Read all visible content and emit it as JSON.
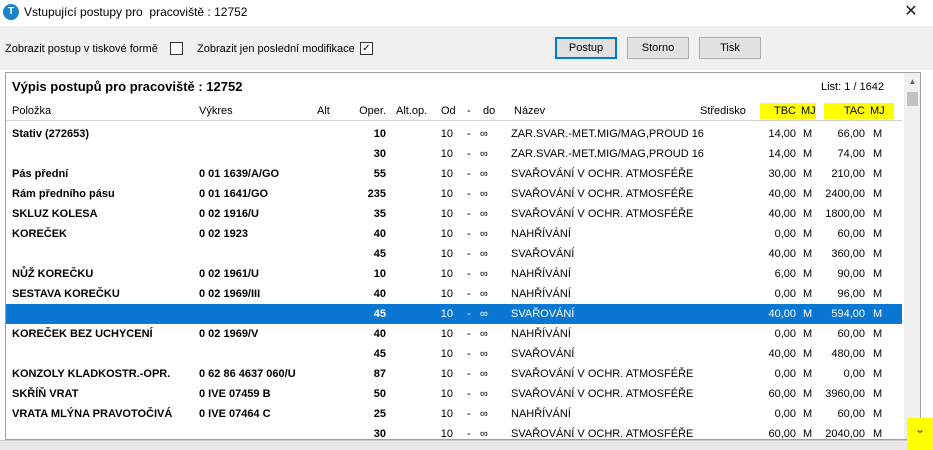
{
  "window": {
    "title": "Vstupující postupy pro  pracoviště : 12752",
    "app_icon": "app-logo-icon",
    "close_glyph": "✕"
  },
  "toolbar": {
    "option1_label": "Zobrazit postup v tiskové formě",
    "option1_checked": false,
    "option2_label": "Zobrazit jen poslední modifikace",
    "option2_checked": true,
    "check_glyph": "✓",
    "btn_postup": "Postup",
    "btn_storno": "Storno",
    "btn_tisk": "Tisk"
  },
  "report": {
    "title": "Výpis postupů pro pracoviště : 12752",
    "page_info": "List: 1 / 1642"
  },
  "columns": {
    "polozka": "Položka",
    "vykres": "Výkres",
    "alt": "Alt",
    "oper": "Oper.",
    "altop": "Alt.op.",
    "od": "Od",
    "dash": "-",
    "do": "do",
    "nazev": "Název",
    "stredisko": "Středisko",
    "tbc": "TBC",
    "mj1": "MJ",
    "tac": "TAC",
    "mj2": "MJ"
  },
  "highlight_color": "#ffff00",
  "selection_color": "#0a78d3",
  "rows": [
    {
      "polozka": "Stativ (272653)",
      "vykres": "",
      "oper": "10",
      "od": "10",
      "dash": "-",
      "do": "∞",
      "nazev": "ZAR.SVAR.-MET.MIG/MAG,PROUD 16",
      "tbc": "14,00",
      "mj1": "M",
      "tac": "66,00",
      "mj2": "M",
      "selected": false
    },
    {
      "polozka": "",
      "vykres": "",
      "oper": "30",
      "od": "10",
      "dash": "-",
      "do": "∞",
      "nazev": "ZAR.SVAR.-MET.MIG/MAG,PROUD 16",
      "tbc": "14,00",
      "mj1": "M",
      "tac": "74,00",
      "mj2": "M",
      "selected": false
    },
    {
      "polozka": "Pás přední",
      "vykres": "0 01 1639/A/GO",
      "oper": "55",
      "od": "10",
      "dash": "-",
      "do": "∞",
      "nazev": "SVAŘOVÁNÍ V OCHR. ATMOSFÉŘE",
      "tbc": "30,00",
      "mj1": "M",
      "tac": "210,00",
      "mj2": "M",
      "selected": false
    },
    {
      "polozka": "Rám předního pásu",
      "vykres": "0 01 1641/GO",
      "oper": "235",
      "od": "10",
      "dash": "-",
      "do": "∞",
      "nazev": "SVAŘOVÁNÍ V OCHR. ATMOSFÉŘE",
      "tbc": "40,00",
      "mj1": "M",
      "tac": "2400,00",
      "mj2": "M",
      "selected": false
    },
    {
      "polozka": "SKLUZ KOLESA",
      "vykres": "0 02 1916/U",
      "oper": "35",
      "od": "10",
      "dash": "-",
      "do": "∞",
      "nazev": "SVAŘOVÁNÍ V OCHR. ATMOSFÉŘE",
      "tbc": "40,00",
      "mj1": "M",
      "tac": "1800,00",
      "mj2": "M",
      "selected": false
    },
    {
      "polozka": "KOREČEK",
      "vykres": "0 02 1923",
      "oper": "40",
      "od": "10",
      "dash": "-",
      "do": "∞",
      "nazev": "NAHŘÍVÁNÍ",
      "tbc": "0,00",
      "mj1": "M",
      "tac": "60,00",
      "mj2": "M",
      "selected": false
    },
    {
      "polozka": "",
      "vykres": "",
      "oper": "45",
      "od": "10",
      "dash": "-",
      "do": "∞",
      "nazev": "SVAŘOVÁNÍ",
      "tbc": "40,00",
      "mj1": "M",
      "tac": "360,00",
      "mj2": "M",
      "selected": false
    },
    {
      "polozka": "NŮŽ KOREČKU",
      "vykres": "0 02 1961/U",
      "oper": "10",
      "od": "10",
      "dash": "-",
      "do": "∞",
      "nazev": "NAHŘÍVÁNÍ",
      "tbc": "6,00",
      "mj1": "M",
      "tac": "90,00",
      "mj2": "M",
      "selected": false
    },
    {
      "polozka": "SESTAVA KOREČKU",
      "vykres": "0 02 1969/III",
      "oper": "40",
      "od": "10",
      "dash": "-",
      "do": "∞",
      "nazev": "NAHŘÍVÁNÍ",
      "tbc": "0,00",
      "mj1": "M",
      "tac": "96,00",
      "mj2": "M",
      "selected": false
    },
    {
      "polozka": "",
      "vykres": "",
      "oper": "45",
      "od": "10",
      "dash": "-",
      "do": "∞",
      "nazev": "SVAŘOVÁNÍ",
      "tbc": "40,00",
      "mj1": "M",
      "tac": "594,00",
      "mj2": "M",
      "selected": true
    },
    {
      "polozka": "KOREČEK BEZ UCHYCENÍ",
      "vykres": "0 02 1969/V",
      "oper": "40",
      "od": "10",
      "dash": "-",
      "do": "∞",
      "nazev": "NAHŘÍVÁNÍ",
      "tbc": "0,00",
      "mj1": "M",
      "tac": "60,00",
      "mj2": "M",
      "selected": false
    },
    {
      "polozka": "",
      "vykres": "",
      "oper": "45",
      "od": "10",
      "dash": "-",
      "do": "∞",
      "nazev": "SVAŘOVÁNÍ",
      "tbc": "40,00",
      "mj1": "M",
      "tac": "480,00",
      "mj2": "M",
      "selected": false
    },
    {
      "polozka": "KONZOLY KLADKOSTR.-OPR.",
      "vykres": "0 62 86 4637 060/U",
      "oper": "87",
      "od": "10",
      "dash": "-",
      "do": "∞",
      "nazev": "SVAŘOVÁNÍ V OCHR. ATMOSFÉŘE",
      "tbc": "0,00",
      "mj1": "M",
      "tac": "0,00",
      "mj2": "M",
      "selected": false
    },
    {
      "polozka": "SKŘÍŇ VRAT",
      "vykres": "0 IVE 07459 B",
      "oper": "50",
      "od": "10",
      "dash": "-",
      "do": "∞",
      "nazev": "SVAŘOVÁNÍ V OCHR. ATMOSFÉŘE",
      "tbc": "60,00",
      "mj1": "M",
      "tac": "3960,00",
      "mj2": "M",
      "selected": false
    },
    {
      "polozka": "VRATA MLÝNA PRAVOTOČIVÁ",
      "vykres": "0 IVE 07464 C",
      "oper": "25",
      "od": "10",
      "dash": "-",
      "do": "∞",
      "nazev": "NAHŘÍVÁNÍ",
      "tbc": "0,00",
      "mj1": "M",
      "tac": "60,00",
      "mj2": "M",
      "selected": false
    },
    {
      "polozka": "",
      "vykres": "",
      "oper": "30",
      "od": "10",
      "dash": "-",
      "do": "∞",
      "nazev": "SVAŘOVÁNÍ V OCHR. ATMOSFÉŘE",
      "tbc": "60,00",
      "mj1": "M",
      "tac": "2040,00",
      "mj2": "M",
      "selected": false
    }
  ],
  "scroll": {
    "up_glyph": "▲",
    "resize_glyph": "⌄"
  }
}
